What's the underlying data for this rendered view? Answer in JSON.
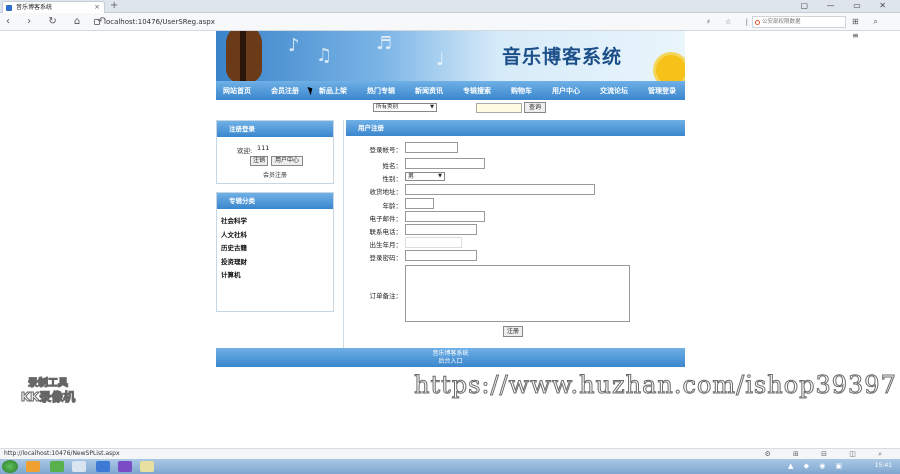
{
  "browser": {
    "tab_title": "音乐博客系统",
    "tab_close": "×",
    "new_tab": "+",
    "window_controls": "▢ — ▭ ✕",
    "nav_icons": "‹ › ↻ ⌂ ↶",
    "url": "localhost:10476/UserSReg.aspx",
    "addr_icons": "⚡ ☆ | ⇲",
    "search_placeholder": "公安部权限数据",
    "toolbar_icons": "⊞ ⌕ ≡"
  },
  "site": {
    "banner_title": "音乐博客系统",
    "menu": [
      "网站首页",
      "会员注册",
      "新品上架",
      "热门专辑",
      "新闻资讯",
      "专辑搜索",
      "购物车",
      "用户中心",
      "交流论坛",
      "管理登录"
    ],
    "search": {
      "select_value": "所有类别",
      "button": "查询"
    }
  },
  "login_box": {
    "title": "注册登录",
    "welcome": "欢迎:",
    "username": "111",
    "logout_button": "注销",
    "user_center_button": "用户中心",
    "register_link": "会员注册"
  },
  "category_box": {
    "title": "专辑分类",
    "items": [
      "社会科学",
      "人文社科",
      "历史古籍",
      "投资理财",
      "计算机"
    ]
  },
  "register_form": {
    "title": "用户注册",
    "account_label": "登录帐号：",
    "name_label": "姓名：",
    "gender_label": "性别：",
    "gender_value": "男",
    "address_label": "收货地址：",
    "age_label": "年龄：",
    "email_label": "电子邮件：",
    "phone_label": "联系电话：",
    "birth_label": "出生年月：",
    "password_label": "登录密码：",
    "notes_label": "订单备注：",
    "submit_button": "注册"
  },
  "footer": {
    "line1": "音乐博客系统",
    "line2": "后台入口"
  },
  "overlay": {
    "watermark": "https://www.huzhan.com/ishop39397",
    "kk_line1": "录制工具",
    "kk_line2": "KK录像机"
  },
  "status_bar": {
    "url": "http://localhost:10476/NewSPList.aspx",
    "icons": "⚙ ⊞ ⊟ ◫ ⌕"
  },
  "taskbar": {
    "clock": "15:41",
    "tray": "▲ ◆ ◉ ▣"
  }
}
